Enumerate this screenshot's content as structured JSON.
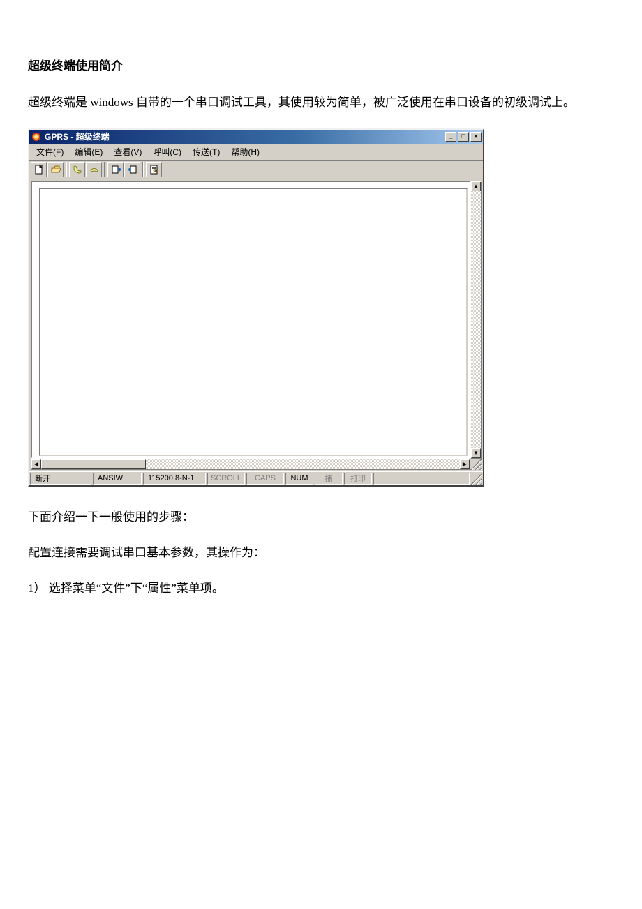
{
  "doc": {
    "heading": "超级终端使用简介",
    "intro": "超级终端是 windows 自带的一个串口调试工具，其使用较为简单，被广泛使用在串口设备的初级调试上。",
    "steps_intro": "下面介绍一下一般使用的步骤：",
    "config_intro": "配置连接需要调试串口基本参数，其操作为：",
    "step1": "1） 选择菜单“文件”下“属性”菜单项。"
  },
  "win": {
    "title": "GPRS - 超级终端",
    "btn_min": "_",
    "btn_max": "□",
    "btn_close": "×",
    "menu": {
      "file": "文件(F)",
      "edit": "编辑(E)",
      "view": "查看(V)",
      "call": "呼叫(C)",
      "transfer": "传送(T)",
      "help": "帮助(H)"
    },
    "status": {
      "conn": "断开",
      "enc": "ANSIW",
      "baud": "115200 8-N-1",
      "scroll": "SCROLL",
      "caps": "CAPS",
      "num": "NUM",
      "capture": "捕",
      "print": "打印"
    },
    "scroll": {
      "up": "▲",
      "down": "▼",
      "left": "◀",
      "right": "▶"
    }
  }
}
